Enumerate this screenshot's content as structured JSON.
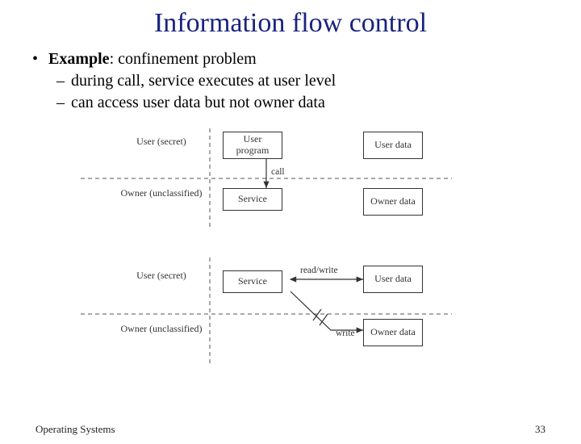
{
  "title": "Information flow control",
  "bullets": {
    "l1_lead": "Example",
    "l1_rest": ": confinement problem",
    "l2a": "during call, service executes at user level",
    "l2b": "can access user data but not owner data"
  },
  "diagram": {
    "top": {
      "user_left": "User\n(secret)",
      "user_prog": "User\nprogram",
      "user_data": "User\ndata",
      "owner_left": "Owner\n(unclassified)",
      "service": "Service",
      "owner_data": "Owner\ndata",
      "call_label": "call"
    },
    "bottom": {
      "user_left": "User\n(secret)",
      "service": "Service",
      "user_data": "User\ndata",
      "owner_left": "Owner\n(unclassified)",
      "owner_data": "Owner\ndata",
      "readwrite_label": "read/write",
      "write_label": "write"
    }
  },
  "footer": {
    "left": "Operating Systems",
    "right": "33"
  }
}
